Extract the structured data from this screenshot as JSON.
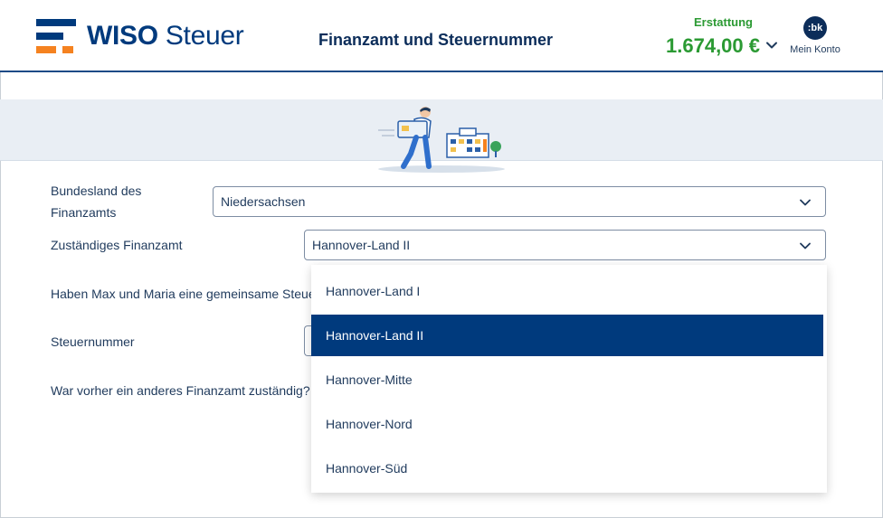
{
  "app": {
    "logo_text_bold": "WISO",
    "logo_text_rest": "Steuer",
    "page_title": "Finanzamt und Steuernummer"
  },
  "refund": {
    "label": "Erstattung",
    "amount": "1.674,00 €"
  },
  "account": {
    "avatar_text": ":bk",
    "label": "Mein Konto"
  },
  "form": {
    "bundesland": {
      "label_line1": "Bundesland des",
      "label_line2": "Finanzamts",
      "value": "Niedersachsen"
    },
    "finanzamt": {
      "label": "Zuständiges Finanzamt",
      "value": "Hannover-Land II"
    },
    "gemeinsame_steuer": {
      "label": "Haben Max und Maria eine gemeinsame Steue"
    },
    "steuernummer": {
      "label": "Steuernummer"
    },
    "vorher": {
      "label": "War vorher ein anderes Finanzamt zuständig?"
    }
  },
  "dropdown": {
    "options": [
      "Hannover-Land I",
      "Hannover-Land II",
      "Hannover-Mitte",
      "Hannover-Nord",
      "Hannover-Süd"
    ],
    "selected": "Hannover-Land II"
  },
  "colors": {
    "brand_blue": "#003a7d",
    "brand_orange": "#f58220",
    "refund_green": "#2b9a33",
    "selected_bg": "#003a7d"
  },
  "icons": {
    "refund_toggle": "chevron-down-icon",
    "select_toggle": "chevron-down-icon"
  }
}
